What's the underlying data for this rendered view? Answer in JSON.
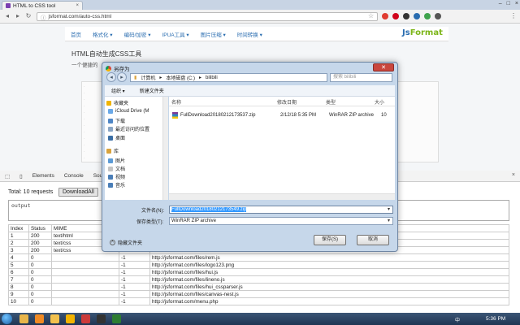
{
  "browser": {
    "tab_title": "HTML to CSS tool",
    "tab_close": "×",
    "window_controls": [
      "–",
      "□",
      "×"
    ],
    "url": "jsformat.com/auto-css.html",
    "nav_icons": [
      "back-icon",
      "forward-icon",
      "reload-icon"
    ],
    "extension_colors": [
      "#e03c31",
      "#d0021b",
      "#333333",
      "#2a6db0",
      "#3fa34d",
      "#555555"
    ]
  },
  "site": {
    "nav": [
      "首页",
      "格式化 ▾",
      "编码/加密 ▾",
      "IPUA工具 ▾",
      "图片压缩 ▾",
      "时间转换 ▾"
    ],
    "logo_a": "Js",
    "logo_b": "Format",
    "heading": "HTML自动生成CSS工具",
    "subtitle": "一个便捷的"
  },
  "devtools": {
    "tabs": [
      "Elements",
      "Console",
      "Sou"
    ],
    "close": "×",
    "total_label": "Total: 10 requests",
    "download_all": "DownloadAll",
    "output_text": "output",
    "table_header": [
      "Index",
      "Status",
      "MIME",
      "",
      ""
    ],
    "rows": [
      [
        "1",
        "200",
        "text/html",
        "",
        ""
      ],
      [
        "2",
        "200",
        "text/css",
        "",
        ""
      ],
      [
        "3",
        "200",
        "text/css",
        "",
        ""
      ],
      [
        "4",
        "0",
        "",
        "-1",
        "http://jsformat.com/files/rem.js"
      ],
      [
        "5",
        "0",
        "",
        "-1",
        "http://jsformat.com/files/logo123.png"
      ],
      [
        "6",
        "0",
        "",
        "-1",
        "http://jsformat.com/files/hui.js"
      ],
      [
        "7",
        "0",
        "",
        "-1",
        "http://jsformat.com/files/lineno.js"
      ],
      [
        "8",
        "0",
        "",
        "-1",
        "http://jsformat.com/files/hui_cssparser.js"
      ],
      [
        "9",
        "0",
        "",
        "-1",
        "http://jsformat.com/files/canvas-nest.js"
      ],
      [
        "10",
        "0",
        "",
        "-1",
        "http://jsformat.com/menu.php"
      ]
    ]
  },
  "dialog": {
    "title": "另存为",
    "close": "✕",
    "path": [
      "计算机",
      "本地磁盘 (C:)",
      "bilibili"
    ],
    "search_placeholder": "搜索 bilibili",
    "toolbar": [
      "组织 ▾",
      "新建文件夹"
    ],
    "sidebar": [
      {
        "label": "收藏夹",
        "icon": "star-icon",
        "color": "#f0b400"
      },
      {
        "label": "iCloud Drive (M",
        "icon": "cloud-folder-icon",
        "color": "#6aa9e8"
      },
      {
        "label": "下载",
        "icon": "download-folder-icon",
        "color": "#4f86c6"
      },
      {
        "label": "最近访问的位置",
        "icon": "recent-places-icon",
        "color": "#8aa6c5"
      },
      {
        "label": "桌面",
        "icon": "desktop-icon",
        "color": "#3a6ea5"
      },
      {
        "label": "库",
        "icon": "library-icon",
        "color": "#d9a33d"
      },
      {
        "label": "图片",
        "icon": "pictures-icon",
        "color": "#5c9bd6"
      },
      {
        "label": "文档",
        "icon": "documents-icon",
        "color": "#c4c4c4"
      },
      {
        "label": "视频",
        "icon": "videos-icon",
        "color": "#4a7eb7"
      },
      {
        "label": "音乐",
        "icon": "music-icon",
        "color": "#4a7eb7"
      }
    ],
    "columns": [
      "名称",
      "修改日期",
      "类型",
      "大小"
    ],
    "file": {
      "name": "FullDownload20180212173537.zip",
      "date": "2/12/18 5:35 PM",
      "type": "WinRAR ZIP archive",
      "size": "10"
    },
    "filename_label": "文件名(N):",
    "filename_value": "FullDownload20180212173549.zip",
    "type_label": "保存类型(T):",
    "type_value": "WinRAR ZIP archive",
    "hide_folders": "隐藏文件夹",
    "save": "保存(S)",
    "cancel": "取消"
  },
  "taskbar": {
    "icons": [
      {
        "name": "explorer-icon",
        "color": "#e8b54a"
      },
      {
        "name": "media-player-icon",
        "color": "#f08a24"
      },
      {
        "name": "folder-icon",
        "color": "#f2c14e"
      },
      {
        "name": "chrome-icon",
        "color": "#f4b400"
      },
      {
        "name": "app-icon",
        "color": "#cc3b3b"
      },
      {
        "name": "terminal-icon",
        "color": "#333333"
      },
      {
        "name": "editor-icon",
        "color": "#2e7d32"
      }
    ],
    "lang": "中",
    "time": "5:36 PM"
  }
}
